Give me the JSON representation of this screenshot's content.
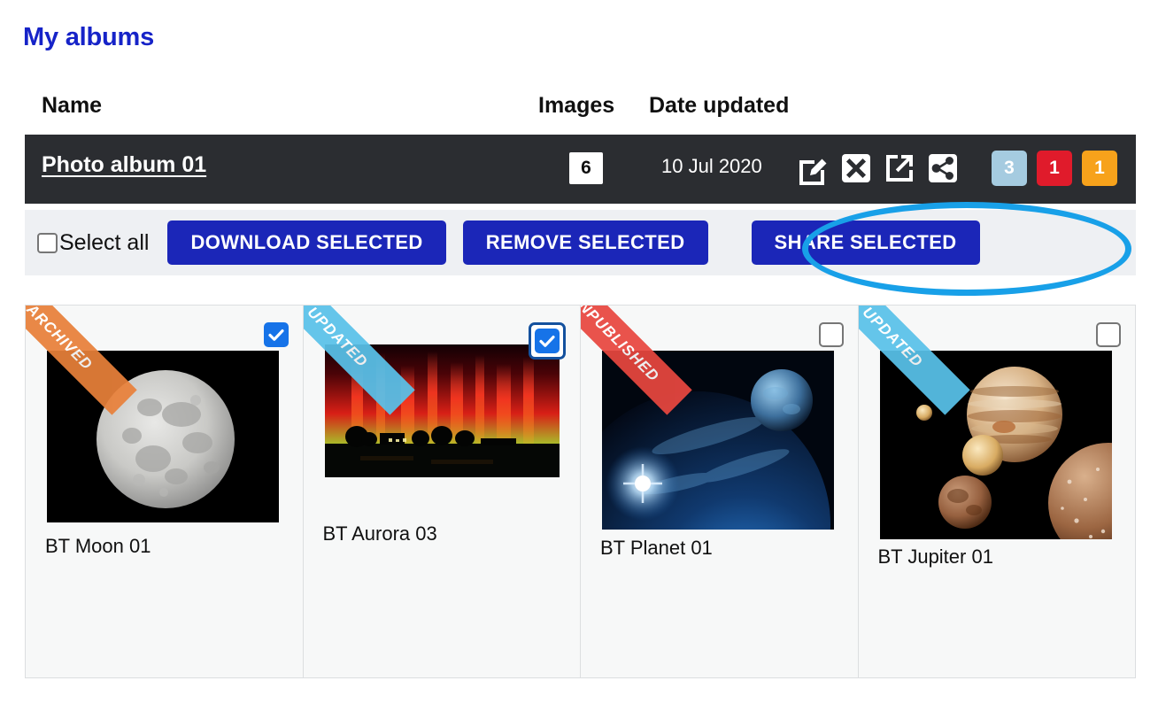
{
  "page": {
    "title": "My albums"
  },
  "table": {
    "headers": {
      "name": "Name",
      "images": "Images",
      "date": "Date updated"
    },
    "album": {
      "name": "Photo album 01",
      "images_count": "6",
      "date_updated": "10 Jul 2020",
      "actions": [
        {
          "name": "edit-album-icon",
          "icon": "edit-icon"
        },
        {
          "name": "delete-album-icon",
          "icon": "close-icon"
        },
        {
          "name": "open-album-icon",
          "icon": "external-link-icon"
        },
        {
          "name": "share-album-icon",
          "icon": "share-icon"
        }
      ],
      "badges": [
        {
          "name": "updated-count-badge",
          "value": "3",
          "color": "#a5cbe0"
        },
        {
          "name": "unpublished-count-badge",
          "value": "1",
          "color": "#e01b2b"
        },
        {
          "name": "archived-count-badge",
          "value": "1",
          "color": "#f7a21b"
        }
      ]
    }
  },
  "toolbar": {
    "select_all_label": "Select all",
    "select_all_checked": false,
    "download_label": "DOWNLOAD SELECTED",
    "remove_label": "REMOVE SELECTED",
    "share_label": "SHARE SELECTED",
    "button_color": "#1b26b8",
    "highlight_color": "#18a0e8"
  },
  "cards": [
    {
      "label": "BT Moon 01",
      "ribbon": "ARCHIVED",
      "ribbon_color": "#e8803a",
      "checked": true,
      "focused": false,
      "image": "moon"
    },
    {
      "label": "BT Aurora 03",
      "ribbon": "UPDATED",
      "ribbon_color": "#59c2ea",
      "checked": true,
      "focused": true,
      "image": "aurora"
    },
    {
      "label": "BT Planet 01",
      "ribbon": "UNPUBLISHED",
      "ribbon_color": "#e8473f",
      "checked": false,
      "focused": false,
      "image": "planet"
    },
    {
      "label": "BT Jupiter 01",
      "ribbon": "UPDATED",
      "ribbon_color": "#59c2ea",
      "checked": false,
      "focused": false,
      "image": "jupiter"
    }
  ]
}
